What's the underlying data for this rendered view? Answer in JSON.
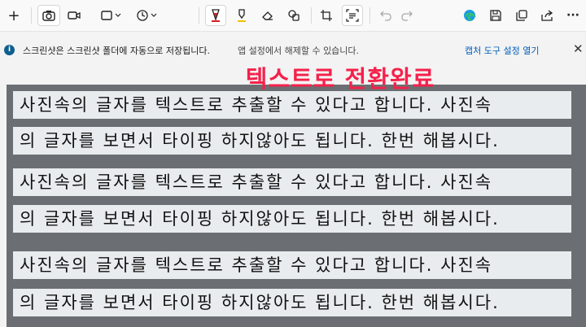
{
  "toolbar": {
    "new_label": "+",
    "capture_mode_icon": "camera-icon",
    "video_icon": "video-icon",
    "shape_icon": "rectangle-select-icon",
    "delay_icon": "clock-icon",
    "pen_icon": "ballpoint-pen-icon",
    "highlighter_icon": "highlighter-icon",
    "eraser_icon": "eraser-icon",
    "shapes_icon": "shapes-icon",
    "crop_icon": "crop-icon",
    "text_actions_icon": "text-actions-icon",
    "undo_icon": "undo-icon",
    "redo_icon": "redo-icon",
    "edge_icon": "browser-icon",
    "save_icon": "save-icon",
    "copy_icon": "copy-icon",
    "share_icon": "share-icon",
    "more_label": "···",
    "accent_color": "#d61f2a",
    "highlighter_color": "#f2c200"
  },
  "infobar": {
    "icon_label": "i",
    "message": "스크린샷은 스크린샷 폴더에 자동으로 저장됩니다.",
    "sub_message": "앱 설정에서 해제할 수 있습니다.",
    "link": "캡처 도구 설정 열기",
    "close_label": "✕"
  },
  "overlay": {
    "title": "텍스트로 전환완료"
  },
  "image_lines": [
    "사진속의 글자를 텍스트로 추출할 수 있다고 합니다. 사진속",
    "의 글자를 보면서 타이핑 하지않아도 됩니다. 한번 해봅시다.",
    "사진속의 글자를 텍스트로 추출할 수 있다고 합니다. 사진속",
    "의 글자를 보면서 타이핑 하지않아도 됩니다. 한번 해봅시다.",
    "사진속의 글자를 텍스트로 추출할 수 있다고 합니다. 사진속",
    "의 글자를 보면서 타이핑 하지않아도 됩니다. 한번 해봅시다."
  ]
}
